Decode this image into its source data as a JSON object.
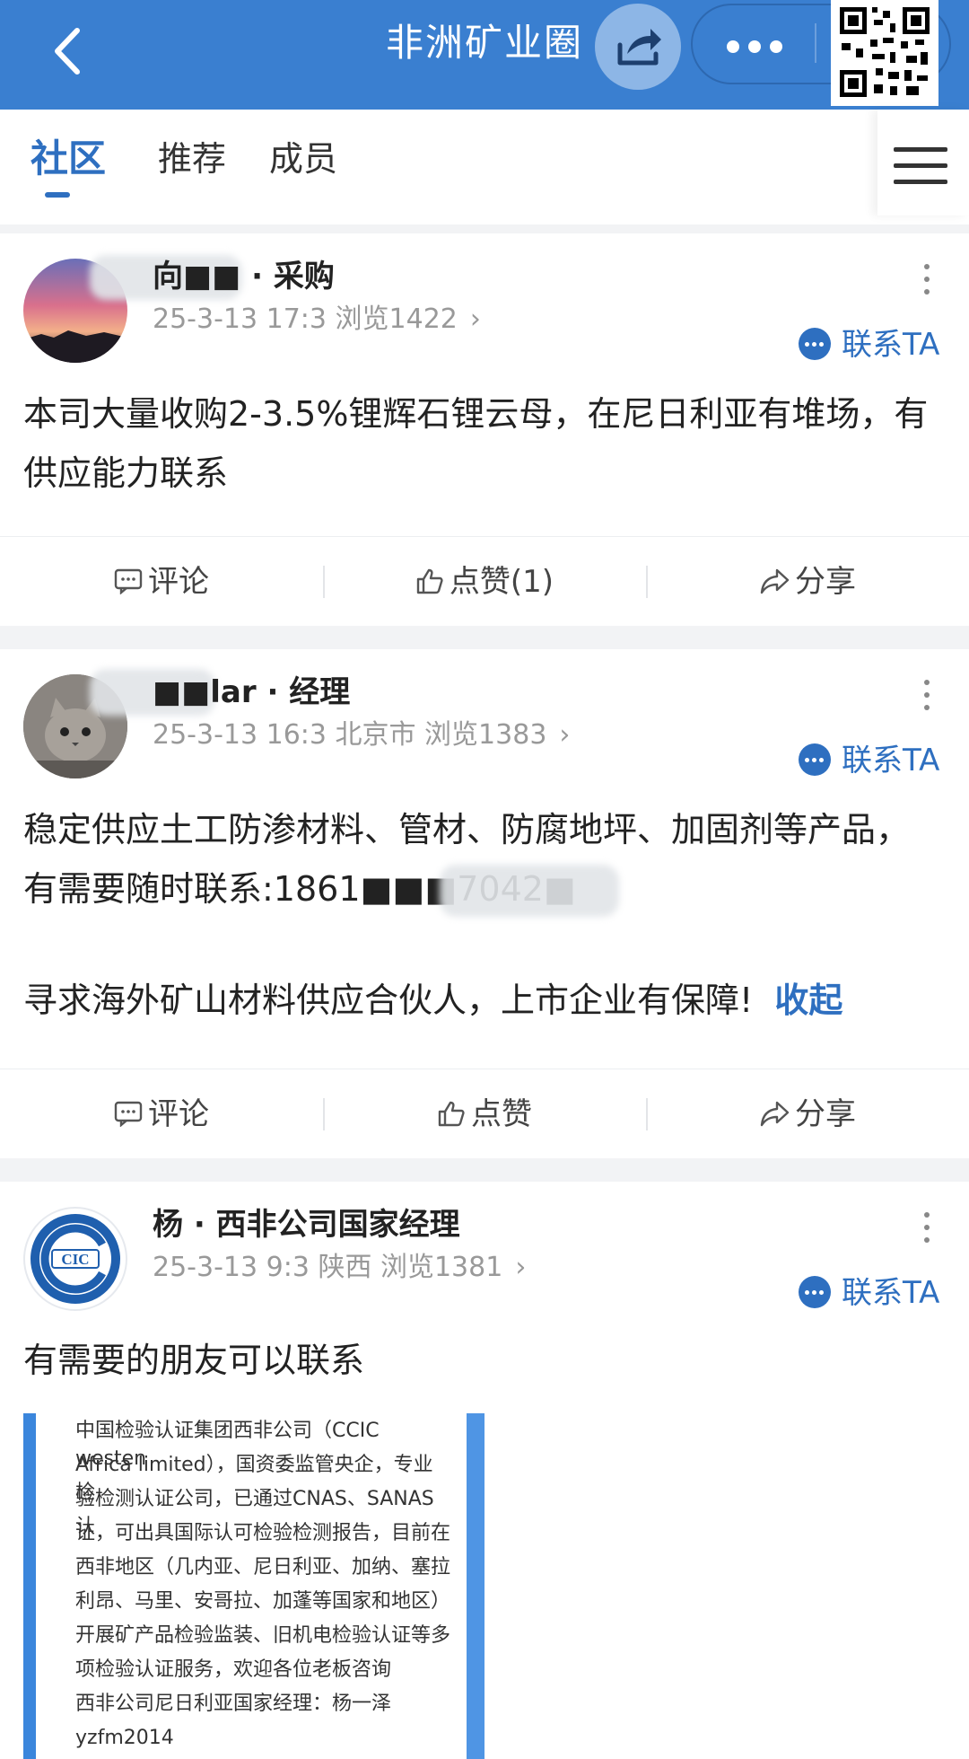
{
  "header": {
    "title": "非洲矿业圈"
  },
  "tabs": [
    {
      "label": "社区",
      "active": true
    },
    {
      "label": "推荐",
      "active": false
    },
    {
      "label": "成员",
      "active": false
    }
  ],
  "posts": [
    {
      "author": "向■■ · 采购",
      "meta": "25-3-13 17:3  浏览1422",
      "contact_label": "联系TA",
      "text": "本司大量收购2-3.5%锂辉石锂云母，在尼日利亚有堆场，有供应能力联系",
      "actions": {
        "comment": "评论",
        "like": "点赞(1)",
        "share": "分享"
      }
    },
    {
      "author": "■■lar · 经理",
      "meta": "25-3-13 16:3  北京市  浏览1383",
      "contact_label": "联系TA",
      "text_line1": "稳定供应土工防渗材料、管材、防腐地坪、加固剂等产品，有需要随时联系:1861■■■7042■",
      "text_line2": "寻求海外矿山材料供应合伙人，上市企业有保障!",
      "collapse_label": "收起",
      "actions": {
        "comment": "评论",
        "like": "点赞",
        "share": "分享"
      }
    },
    {
      "author": "杨 · 西非公司国家经理",
      "meta": "25-3-13 9:3  陕西  浏览1381",
      "contact_label": "联系TA",
      "avatar_logo": "CIC",
      "text": "有需要的朋友可以联系",
      "image_lines": [
        "中国检验认证集团西非公司（CCIC westen",
        "Africa limited），国资委监管央企，专业检",
        "验检测认证公司，已通过CNAS、SANAS认",
        "证，可出具国际认可检验检测报告，目前在",
        "西非地区（几内亚、尼日利亚、加纳、塞拉",
        "利昂、马里、安哥拉、加蓬等国家和地区）",
        "开展矿产品检验监装、旧机电检验认证等多",
        "项检验认证服务，欢迎各位老板咨询",
        "西非公司尼日利亚国家经理：杨一泽",
        "yzfm2014"
      ]
    }
  ],
  "colors": {
    "primary": "#3a7fd0",
    "accent": "#2e6fc0"
  }
}
